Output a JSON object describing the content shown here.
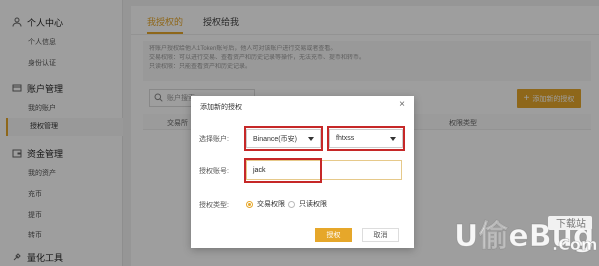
{
  "sidebar": {
    "sections": [
      {
        "title": "个人中心",
        "icon": "user-icon",
        "items": [
          "个人信息",
          "身份认证"
        ]
      },
      {
        "title": "账户管理",
        "icon": "account-icon",
        "items": [
          "我的账户",
          "授权管理"
        ]
      },
      {
        "title": "资金管理",
        "icon": "wallet-icon",
        "items": [
          "我的资产",
          "充币",
          "提币",
          "转币"
        ]
      },
      {
        "title": "量化工具",
        "icon": "tools-icon",
        "items": []
      }
    ],
    "active_item": "授权管理"
  },
  "tabs": [
    {
      "label": "我授权的",
      "active": true
    },
    {
      "label": "授权给我",
      "active": false
    }
  ],
  "notice": [
    "将账户授权给他人1Token账号后，他人可对该账户进行交易或者查看。",
    "交易权限：可以进行交易、查看资产和历史记录等操作，无法充币、提币和转币。",
    "只读权限：只能查看资产和历史记录。"
  ],
  "search": {
    "placeholder": "账户搜索"
  },
  "add_button": {
    "label": "添加新的授权"
  },
  "table": {
    "headers": [
      "交易所",
      "账户",
      "权限类型"
    ]
  },
  "modal": {
    "title": "添加新的授权",
    "close": "×",
    "account_label": "选择账户:",
    "exchange_value": "Binance(币安)",
    "account_value": "fhtxss",
    "authorize_label": "授权账号:",
    "authorize_value": "jack",
    "type_label": "授权类型:",
    "radio_trade": "交易权限",
    "radio_readonly": "只读权限",
    "selected_type": "交易权限",
    "ok": "授权",
    "cancel": "取消"
  },
  "watermark": {
    "text": "U偷eBug",
    "subtext": "下载站",
    "suffix": ".Com"
  },
  "colors": {
    "accent": "#e6a72a",
    "highlight": "#c62828"
  }
}
